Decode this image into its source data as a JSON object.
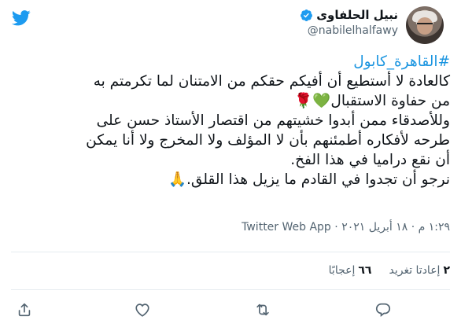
{
  "author": {
    "display_name": "نبيل الحلفاوى",
    "handle": "@nabilelhalfawy",
    "verified_icon": "verified-badge-icon",
    "avatar": "author-avatar"
  },
  "tweet": {
    "hashtag": "#القاهرة_كابول",
    "lines": [
      "كالعادة لا أستطيع أن أفيكم حقكم من الامتنان لما تكرمتم به",
      "من حفاوة الاستقبال",
      "وللأصدقاء ممن أبدوا خشيتهم من اقتصار الأستاذ حسن على",
      "طرحه لأفكاره أطمئنهم بأن لا المؤلف ولا المخرج ولا أنا يمكن",
      "أن نقع دراميا في هذا الفخ.",
      "نرجو أن تجدوا في القادم ما يزيل هذا القلق."
    ],
    "emoji": {
      "green_heart": "💚",
      "rose": "🌹",
      "pray": "🙏"
    }
  },
  "meta": {
    "time": "١:٢٩ م",
    "separator": "·",
    "date": "١٨ أبريل ٢٠٢١",
    "source": "Twitter Web App"
  },
  "stats": {
    "retweets_count": "٢",
    "retweets_label": "إعادتا تغريد",
    "likes_count": "٦٦",
    "likes_label": "إعجابًا"
  },
  "colors": {
    "link": "#1b95e0",
    "muted": "#536471",
    "text": "#0f1419",
    "divider": "#e6ecf0"
  },
  "icons": {
    "reply": "reply-icon",
    "retweet": "retweet-icon",
    "like": "like-icon",
    "share": "share-icon",
    "logo": "twitter-logo-icon"
  }
}
